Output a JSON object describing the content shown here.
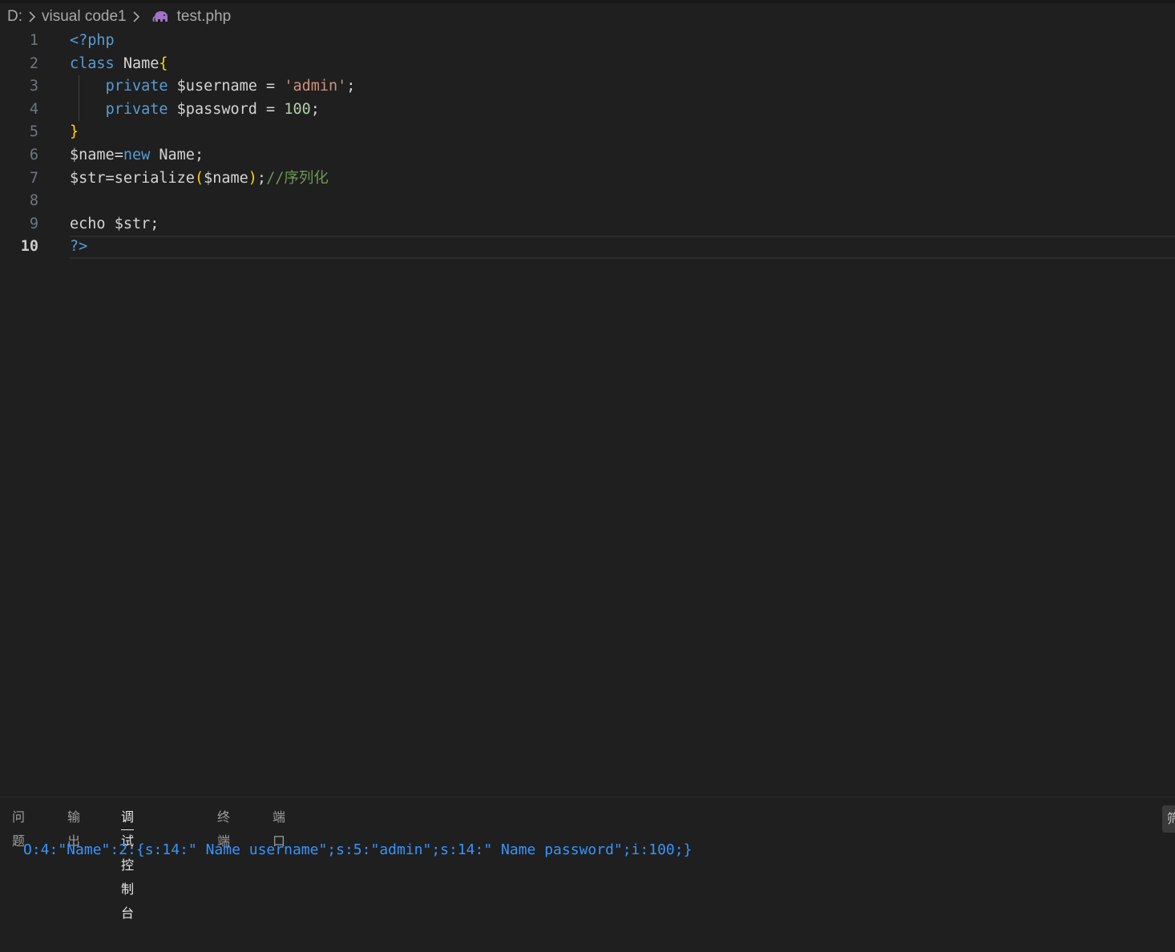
{
  "breadcrumb": {
    "drive": "D:",
    "folder": "visual code1",
    "file": "test.php"
  },
  "icons": {
    "chevron": "chevron-right-icon",
    "file": "php-elephant-icon"
  },
  "colors": {
    "keyword": "#569cd6",
    "php_tag": "#569cd6",
    "brace": "#ffd700",
    "string": "#ce9178",
    "number": "#b5cea8",
    "comment": "#6a9955",
    "console_text": "#3794ff"
  },
  "editor": {
    "active_line": 10,
    "lines": [
      {
        "number": "1",
        "tokens": [
          {
            "text": "<?php",
            "color": "#569cd6"
          }
        ]
      },
      {
        "number": "2",
        "tokens": [
          {
            "text": "class",
            "color": "#569cd6"
          },
          {
            "text": " Name",
            "color": "#d4d4d4"
          },
          {
            "text": "{",
            "color": "#ffd700"
          }
        ]
      },
      {
        "number": "3",
        "tokens": [
          {
            "text": "    ",
            "color": "#d4d4d4"
          },
          {
            "text": "private",
            "color": "#569cd6"
          },
          {
            "text": " $username = ",
            "color": "#d4d4d4"
          },
          {
            "text": "'admin'",
            "color": "#ce9178"
          },
          {
            "text": ";",
            "color": "#d4d4d4"
          }
        ]
      },
      {
        "number": "4",
        "tokens": [
          {
            "text": "    ",
            "color": "#d4d4d4"
          },
          {
            "text": "private",
            "color": "#569cd6"
          },
          {
            "text": " $password = ",
            "color": "#d4d4d4"
          },
          {
            "text": "100",
            "color": "#b5cea8"
          },
          {
            "text": ";",
            "color": "#d4d4d4"
          }
        ]
      },
      {
        "number": "5",
        "tokens": [
          {
            "text": "}",
            "color": "#ffd700"
          }
        ]
      },
      {
        "number": "6",
        "tokens": [
          {
            "text": "$name=",
            "color": "#d4d4d4"
          },
          {
            "text": "new",
            "color": "#569cd6"
          },
          {
            "text": " Name;",
            "color": "#d4d4d4"
          }
        ]
      },
      {
        "number": "7",
        "tokens": [
          {
            "text": "$str=serialize",
            "color": "#d4d4d4"
          },
          {
            "text": "(",
            "color": "#ffd700"
          },
          {
            "text": "$name",
            "color": "#d4d4d4"
          },
          {
            "text": ")",
            "color": "#ffd700"
          },
          {
            "text": ";",
            "color": "#d4d4d4"
          },
          {
            "text": "//序列化",
            "color": "#6a9955"
          }
        ]
      },
      {
        "number": "8",
        "tokens": []
      },
      {
        "number": "9",
        "tokens": [
          {
            "text": "echo $str;",
            "color": "#d4d4d4"
          }
        ]
      },
      {
        "number": "10",
        "tokens": [
          {
            "text": "?>",
            "color": "#569cd6"
          }
        ]
      }
    ]
  },
  "panel": {
    "tabs": [
      {
        "label": "问题",
        "active": false
      },
      {
        "label": "输出",
        "active": false
      },
      {
        "label": "调试控制台",
        "active": true
      },
      {
        "label": "终端",
        "active": false
      },
      {
        "label": "端口",
        "active": false
      }
    ],
    "right_action_label": "筛",
    "console_output": "O:4:\"Name\":2:{s:14:\" Name username\";s:5:\"admin\";s:14:\" Name password\";i:100;}"
  }
}
